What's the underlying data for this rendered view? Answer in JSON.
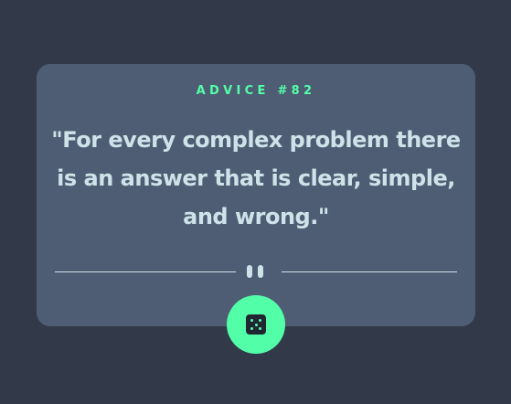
{
  "advice": {
    "label": "ADVICE #82",
    "quote": "\"For every complex problem there is an answer that is clear, simple, and wrong.\""
  },
  "divider": {
    "icon": "pause-icon"
  },
  "dice_button": {
    "icon": "dice-icon"
  },
  "colors": {
    "background": "#323a49",
    "card": "#4e5d73",
    "accent": "#52ffa8",
    "text": "#cee3e9",
    "dice": "#202733"
  }
}
